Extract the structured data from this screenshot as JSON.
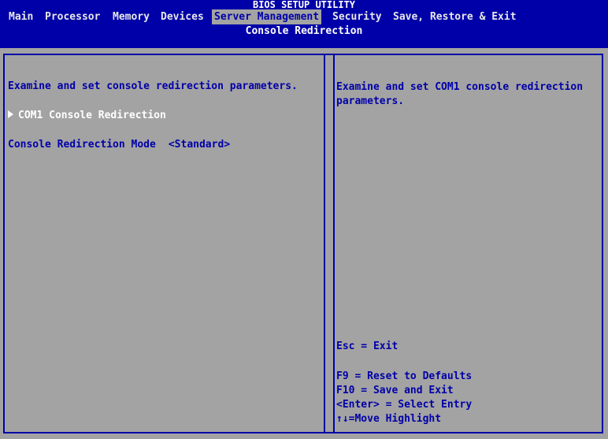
{
  "header": {
    "title": "BIOS SETUP UTILITY",
    "subtitle": "Console Redirection"
  },
  "menu": {
    "items": [
      {
        "label": "Main"
      },
      {
        "label": "Processor"
      },
      {
        "label": "Memory"
      },
      {
        "label": "Devices"
      },
      {
        "label": "Server Management",
        "active": true
      },
      {
        "label": "Security"
      },
      {
        "label": "Save, Restore & Exit"
      }
    ]
  },
  "main": {
    "description": "Examine and set console redirection parameters.",
    "submenu_label": "COM1 Console Redirection",
    "mode_label": "Console Redirection Mode",
    "mode_value": "<Standard>"
  },
  "help": {
    "description_line1": "Examine and set COM1 console redirection",
    "description_line2": "parameters.",
    "esc": "Esc = Exit",
    "f9": "F9 = Reset to Defaults",
    "f10": "F10 = Save and Exit",
    "enter": "<Enter> = Select Entry",
    "move": "↑↓=Move Highlight"
  },
  "colors": {
    "bios_blue": "#0000a8",
    "bios_gray": "#a3a3a3",
    "text_white": "#ffffff"
  }
}
